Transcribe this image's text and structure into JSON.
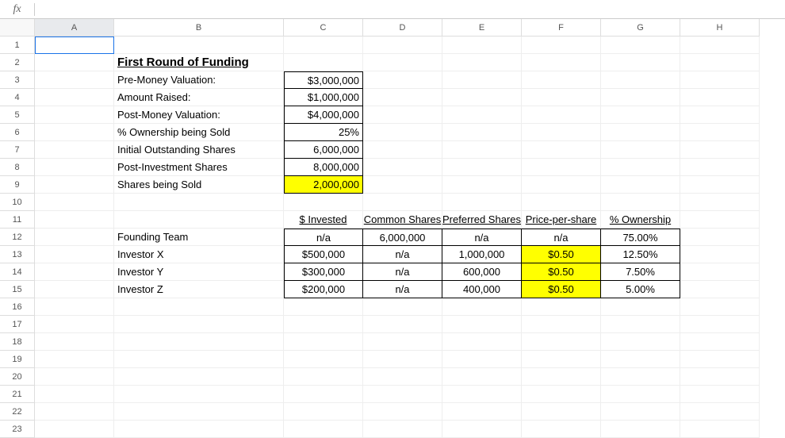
{
  "formula_bar": {
    "fx_label": "fx",
    "value": ""
  },
  "columns": [
    "A",
    "B",
    "C",
    "D",
    "E",
    "F",
    "G",
    "H"
  ],
  "row_count": 23,
  "selected_cell": "A1",
  "section_title": "First Round of Funding",
  "summary": [
    {
      "label": "Pre-Money Valuation:",
      "value": "$3,000,000",
      "highlight": false
    },
    {
      "label": "Amount Raised:",
      "value": "$1,000,000",
      "highlight": false
    },
    {
      "label": "Post-Money Valuation:",
      "value": "$4,000,000",
      "highlight": false
    },
    {
      "label": "% Ownership being Sold",
      "value": "25%",
      "highlight": false
    },
    {
      "label": "Initial Outstanding Shares",
      "value": "6,000,000",
      "highlight": false
    },
    {
      "label": "Post-Investment Shares",
      "value": "8,000,000",
      "highlight": false
    },
    {
      "label": "Shares being Sold",
      "value": "2,000,000",
      "highlight": true
    }
  ],
  "table": {
    "headers": {
      "c": "$ Invested",
      "d": "Common Shares",
      "e": "Preferred Shares",
      "f": "Price-per-share",
      "g": "% Ownership"
    },
    "rows": [
      {
        "name": "Founding Team",
        "invested": "n/a",
        "common": "6,000,000",
        "preferred": "n/a",
        "pps": "n/a",
        "pps_hl": false,
        "own": "75.00%"
      },
      {
        "name": "Investor X",
        "invested": "$500,000",
        "common": "n/a",
        "preferred": "1,000,000",
        "pps": "$0.50",
        "pps_hl": true,
        "own": "12.50%"
      },
      {
        "name": "Investor Y",
        "invested": "$300,000",
        "common": "n/a",
        "preferred": "600,000",
        "pps": "$0.50",
        "pps_hl": true,
        "own": "7.50%"
      },
      {
        "name": "Investor Z",
        "invested": "$200,000",
        "common": "n/a",
        "preferred": "400,000",
        "pps": "$0.50",
        "pps_hl": true,
        "own": "5.00%"
      }
    ]
  },
  "colors": {
    "highlight": "#ffff00",
    "selection": "#1a73e8"
  }
}
